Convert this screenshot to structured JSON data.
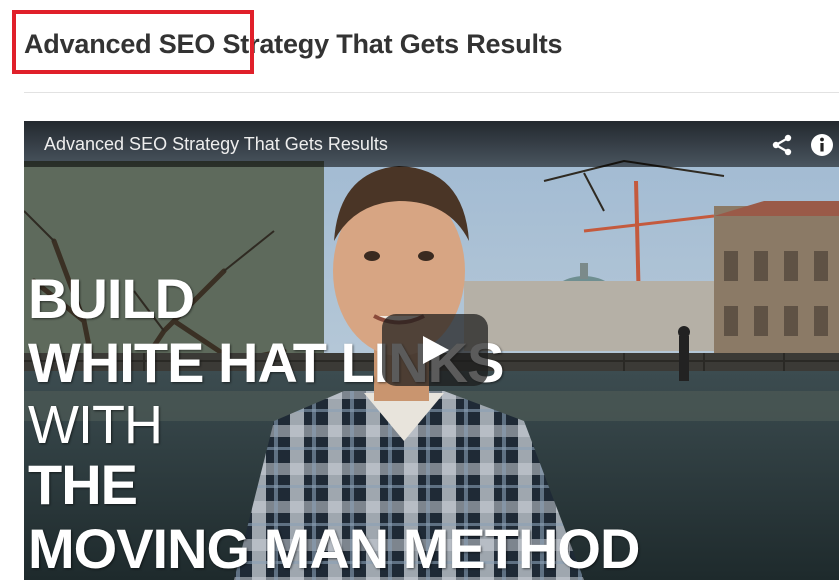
{
  "page": {
    "heading": "Advanced SEO Strategy That Gets Results"
  },
  "video": {
    "title": "Advanced SEO Strategy That Gets Results",
    "overlay_lines": [
      "BUILD",
      "WHITE HAT LINKS",
      "WITH",
      "THE",
      "MOVING MAN METHOD"
    ],
    "icons": {
      "share": "share-icon",
      "info": "info-icon",
      "play": "play-icon"
    }
  },
  "colors": {
    "highlight": "#e0202a",
    "heading": "#333333",
    "overlay_text": "#ffffff"
  }
}
